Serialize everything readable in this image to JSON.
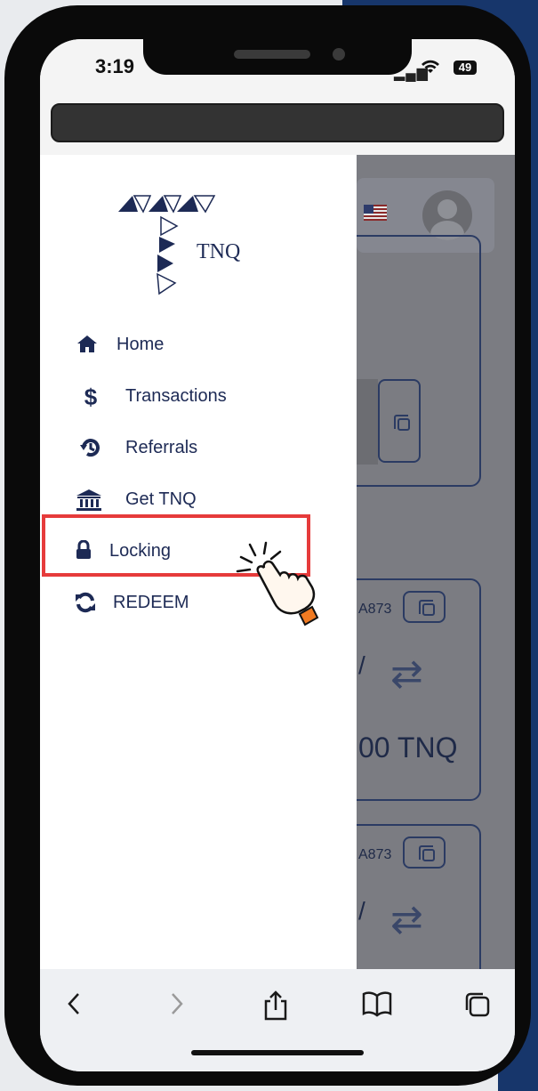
{
  "status_bar": {
    "time": "3:19",
    "battery": "49"
  },
  "brand": {
    "name": "TNQ"
  },
  "menu": {
    "items": [
      {
        "label": "Home",
        "icon": "home-icon"
      },
      {
        "label": "Transactions",
        "icon": "dollar-icon"
      },
      {
        "label": "Referrals",
        "icon": "history-icon"
      },
      {
        "label": "Get TNQ",
        "icon": "bank-icon"
      },
      {
        "label": "Locking",
        "icon": "lock-icon",
        "highlighted": true
      },
      {
        "label": "REDEEM",
        "icon": "refresh-icon"
      }
    ]
  },
  "background_page": {
    "cards": [
      {
        "address_fragment": "A873",
        "amount_fragment": "00 TNQ"
      },
      {
        "address_fragment": "A873"
      }
    ]
  },
  "toolbar": {
    "back": "back-icon",
    "forward": "forward-icon",
    "share": "share-icon",
    "bookmarks": "book-icon",
    "tabs": "tabs-icon"
  },
  "colors": {
    "accent": "#1d2a55",
    "highlight": "#e63b3b",
    "overlay": "#7b7c82"
  }
}
